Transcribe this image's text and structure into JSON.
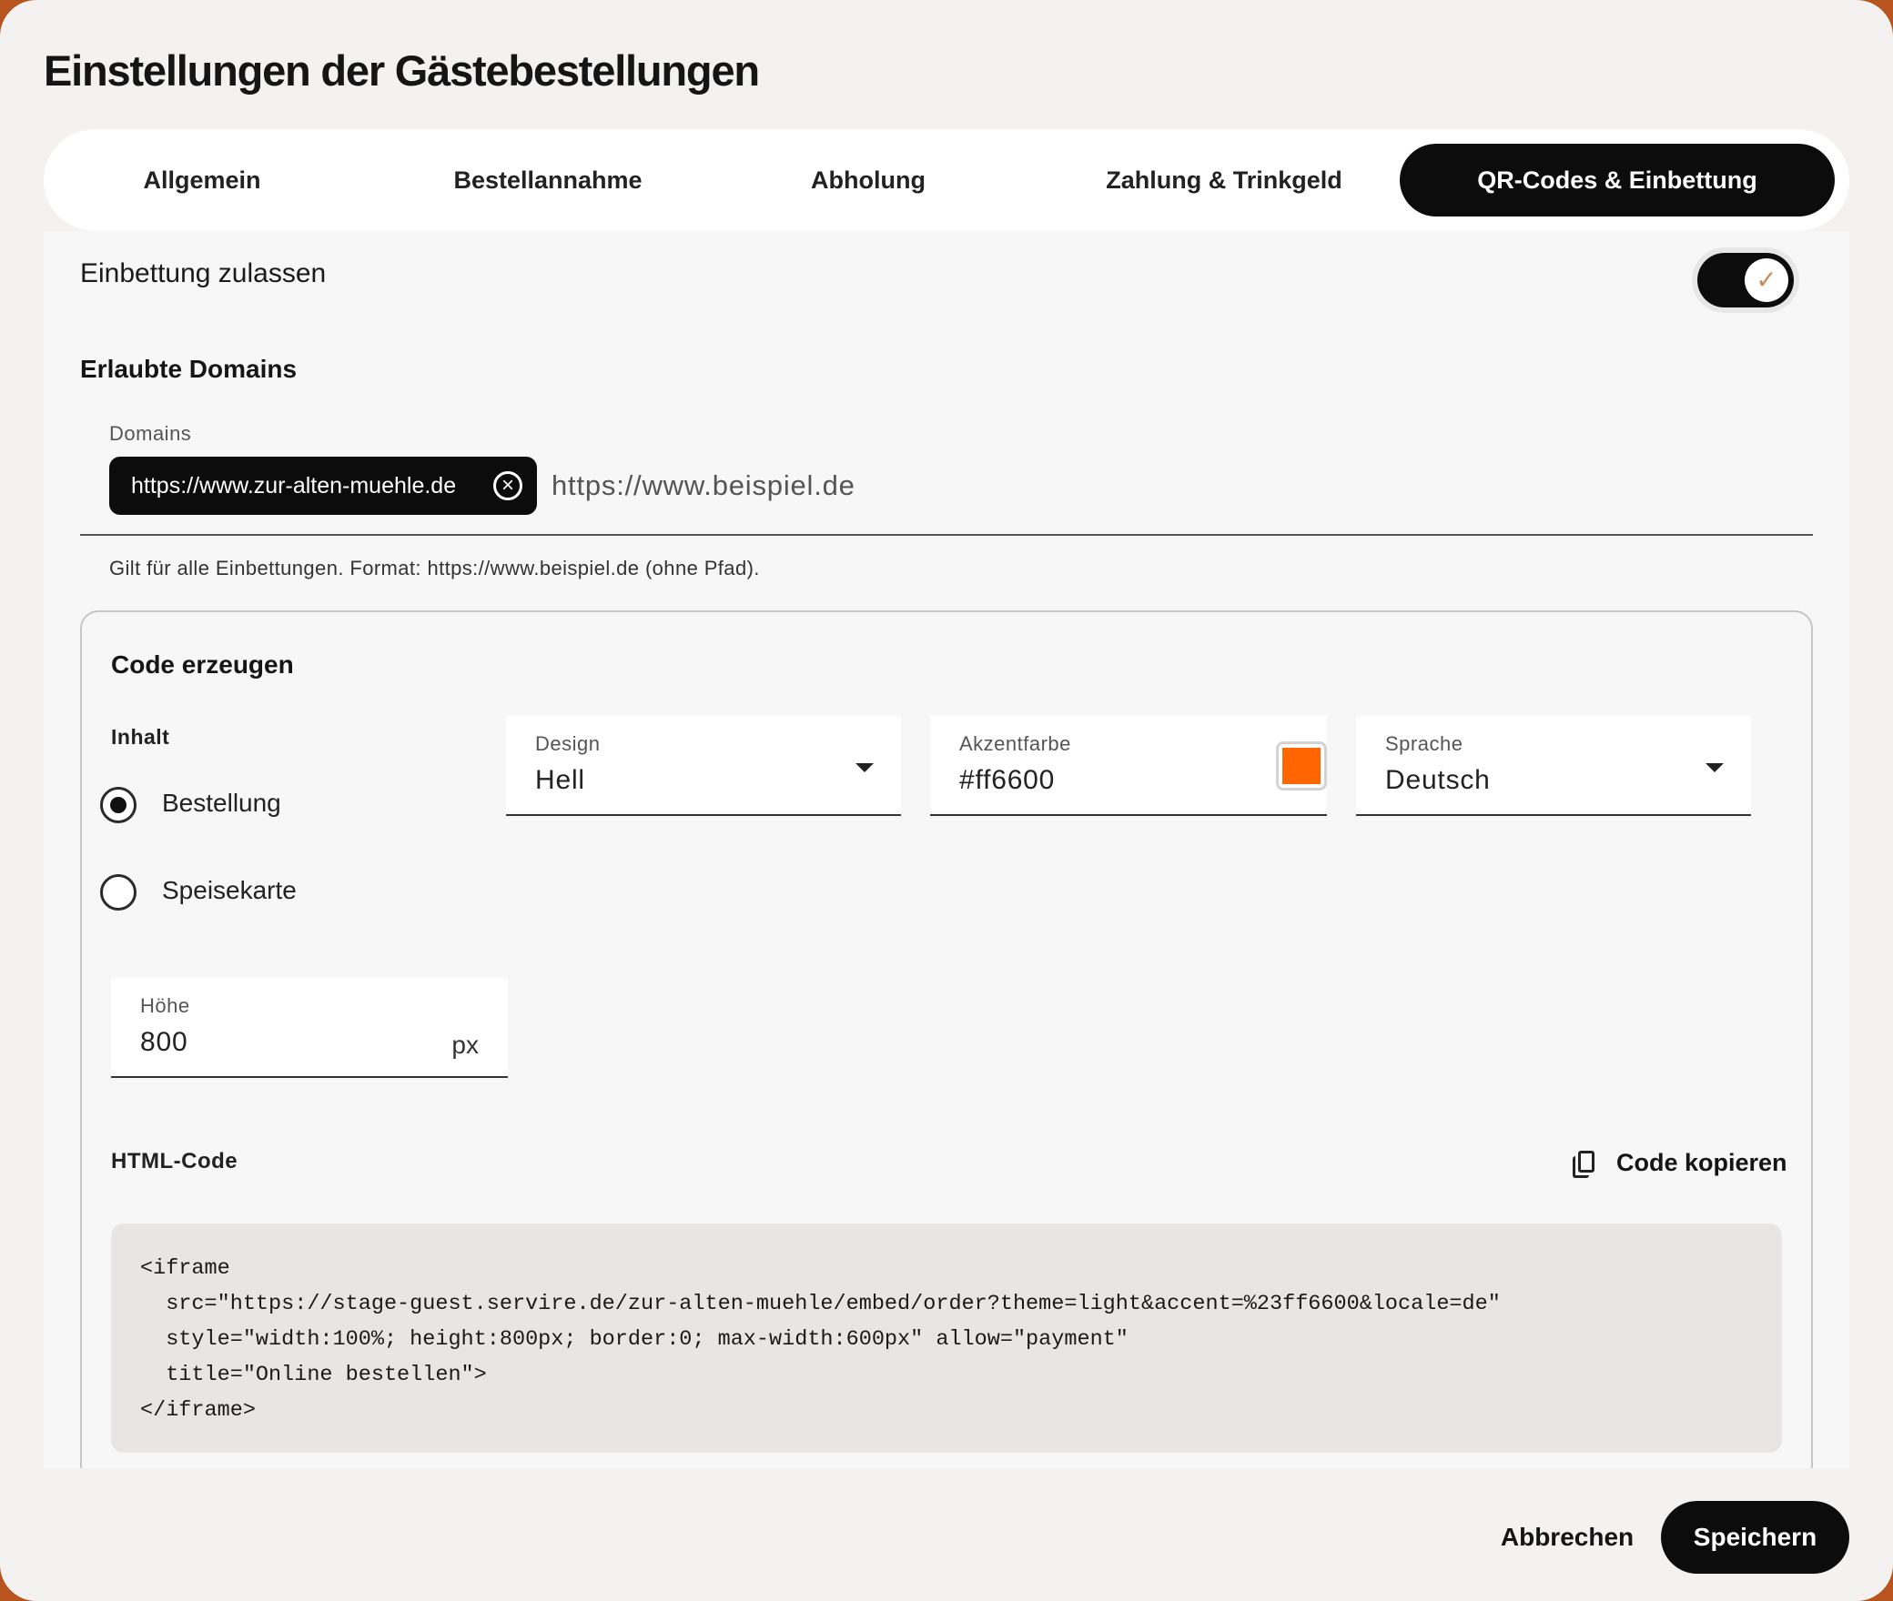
{
  "dialog": {
    "title": "Einstellungen der Gästebestellungen"
  },
  "tabs": [
    {
      "label": "Allgemein",
      "active": false
    },
    {
      "label": "Bestellannahme",
      "active": false
    },
    {
      "label": "Abholung",
      "active": false
    },
    {
      "label": "Zahlung & Trinkgeld",
      "active": false
    },
    {
      "label": "QR-Codes & Einbettung",
      "active": true
    }
  ],
  "embedding": {
    "toggle_label": "Einbettung zulassen",
    "toggle_on": true,
    "domains_section_title": "Erlaubte Domains",
    "domains_field_label": "Domains",
    "domain_chips": [
      "https://www.zur-alten-muehle.de"
    ],
    "domain_input_placeholder": "https://www.beispiel.de",
    "domains_hint": "Gilt für alle Einbettungen. Format: https://www.beispiel.de (ohne Pfad)."
  },
  "code_generator": {
    "title": "Code erzeugen",
    "content_label": "Inhalt",
    "content_options": [
      {
        "label": "Bestellung",
        "selected": true
      },
      {
        "label": "Speisekarte",
        "selected": false
      }
    ],
    "design": {
      "label": "Design",
      "value": "Hell"
    },
    "accent": {
      "label": "Akzentfarbe",
      "value": "#ff6600",
      "swatch_color": "#ff6600"
    },
    "language": {
      "label": "Sprache",
      "value": "Deutsch"
    },
    "height": {
      "label": "Höhe",
      "value": "800",
      "unit": "px"
    },
    "html_code_label": "HTML-Code",
    "copy_button_label": "Code kopieren",
    "code_lines": [
      "<iframe",
      "  src=\"https://stage-guest.servire.de/zur-alten-muehle/embed/order?theme=light&accent=%23ff6600&locale=de\"",
      "  style=\"width:100%; height:800px; border:0; max-width:600px\" allow=\"payment\"",
      "  title=\"Online bestellen\">",
      "</iframe>"
    ]
  },
  "footer": {
    "cancel_label": "Abbrechen",
    "save_label": "Speichern"
  },
  "colors": {
    "primary": "#0c0c0c",
    "background": "#f3f2f1",
    "accent_swatch": "#ff6600",
    "backdrop": "#b8541e"
  },
  "icons": {
    "toggle_check": "check-icon",
    "chip_remove": "close-circle-icon",
    "select_arrow": "caret-down-icon",
    "copy": "copy-icon"
  }
}
